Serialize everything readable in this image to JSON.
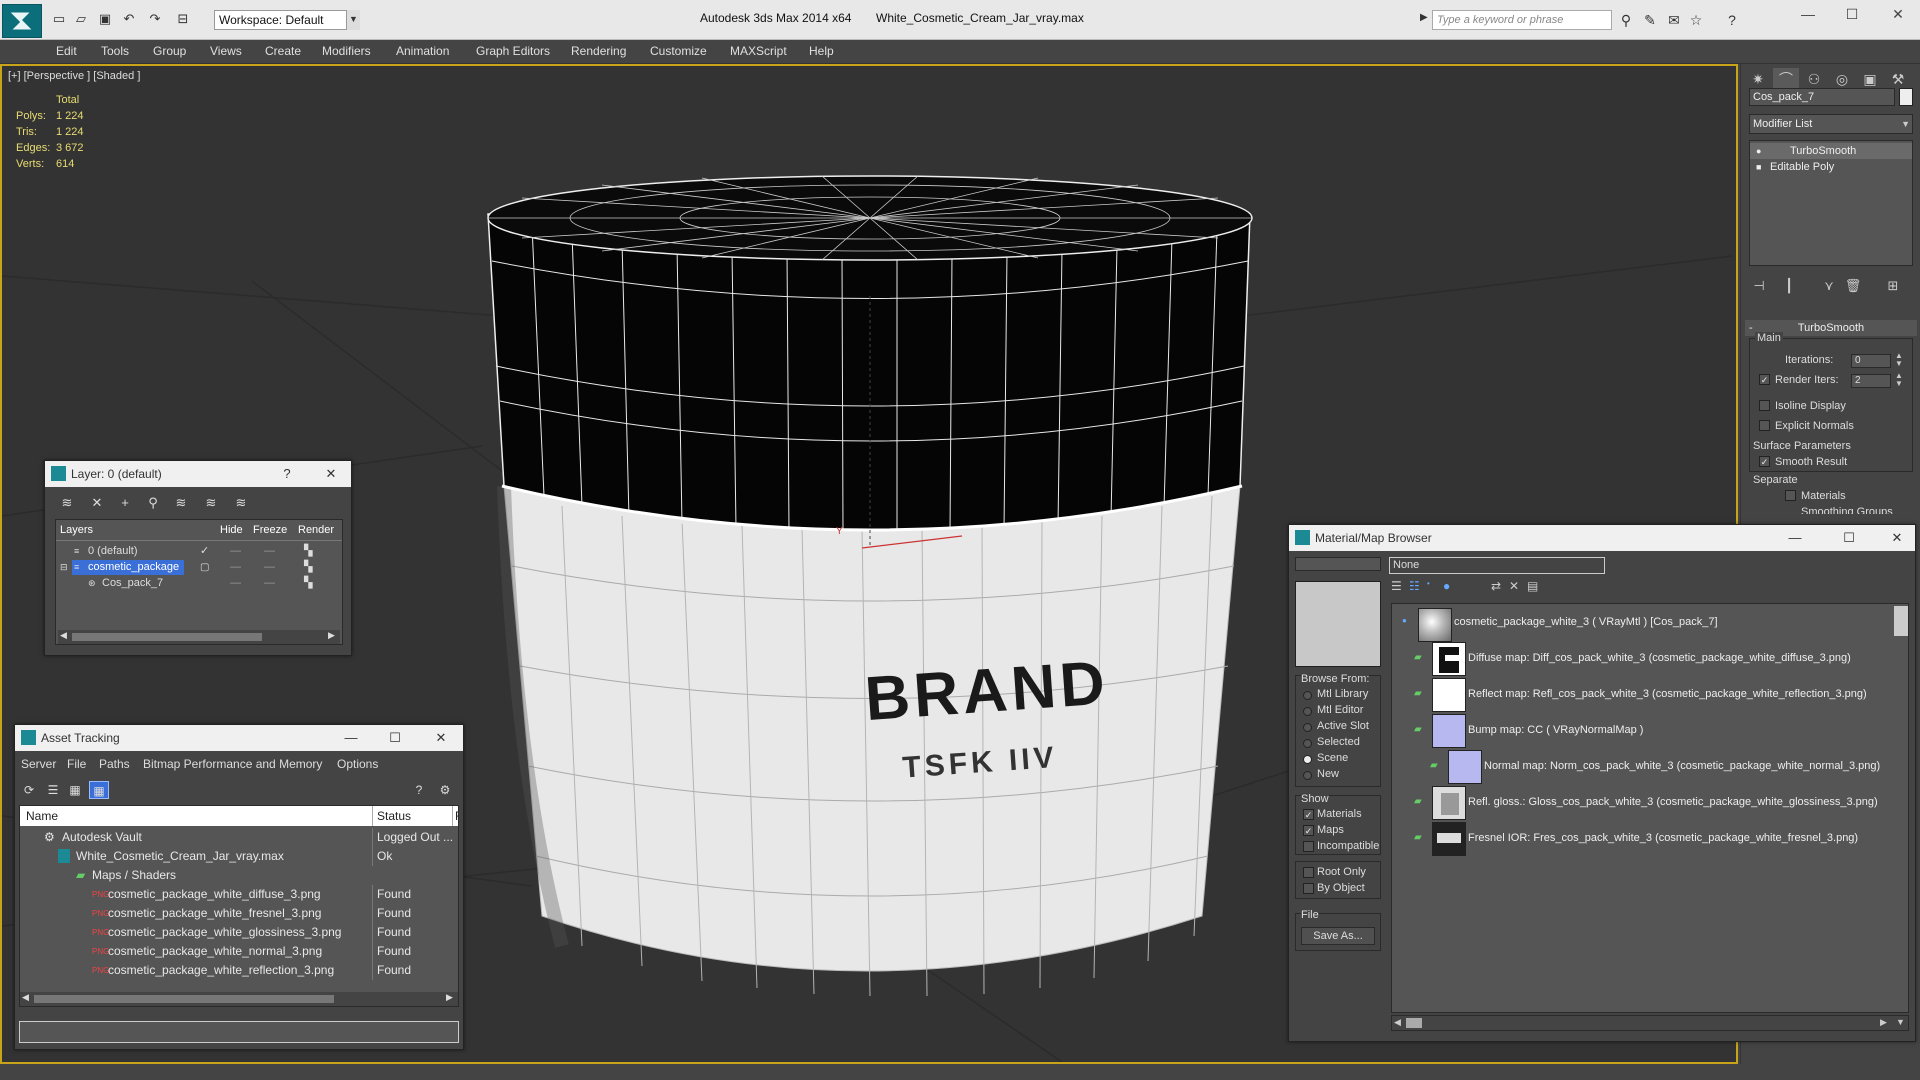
{
  "titlebar": {
    "workspace": "Workspace: Default",
    "app_title": "Autodesk 3ds Max  2014 x64",
    "file_name": "White_Cosmetic_Cream_Jar_vray.max",
    "search_placeholder": "Type a keyword or phrase"
  },
  "menu": {
    "items": [
      "Edit",
      "Tools",
      "Group",
      "Views",
      "Create",
      "Modifiers",
      "Animation",
      "Graph Editors",
      "Rendering",
      "Customize",
      "MAXScript",
      "Help"
    ]
  },
  "viewport": {
    "label": "[+] [Perspective ] [Shaded ]",
    "stats": {
      "header": "Total",
      "polys_label": "Polys:",
      "polys": "1 224",
      "tris_label": "Tris:",
      "tris": "1 224",
      "edges_label": "Edges:",
      "edges": "3 672",
      "verts_label": "Verts:",
      "verts": "614"
    },
    "model_label_brand": "BRAND",
    "model_label_sub": "TSFK IIV"
  },
  "command_panel": {
    "object_name": "Cos_pack_7",
    "modifier_list": "Modifier List",
    "stack": [
      "TurboSmooth",
      "Editable Poly"
    ],
    "turbosmooth": {
      "title": "TurboSmooth",
      "main_label": "Main",
      "iterations_label": "Iterations:",
      "iterations": "0",
      "render_iters_label": "Render Iters:",
      "render_iters": "2",
      "isoline_label": "Isoline Display",
      "explicit_normals_label": "Explicit Normals",
      "surface_params_label": "Surface Parameters",
      "smooth_result_label": "Smooth Result",
      "separate_label": "Separate",
      "materials_label": "Materials",
      "smoothing_groups_label": "Smoothing Groups"
    }
  },
  "layer_window": {
    "title": "Layer: 0 (default)",
    "help": "?",
    "headers": {
      "layers": "Layers",
      "hide": "Hide",
      "freeze": "Freeze",
      "render": "Render"
    },
    "rows": [
      "0 (default)",
      "cosmetic_package",
      "Cos_pack_7"
    ]
  },
  "asset_tracking": {
    "title": "Asset Tracking",
    "menu": [
      "Server",
      "File",
      "Paths",
      "Bitmap Performance and Memory",
      "Options"
    ],
    "headers": {
      "name": "Name",
      "status": "Status",
      "extra": "F"
    },
    "rows": [
      {
        "name": "Autodesk Vault",
        "status": "Logged Out ..."
      },
      {
        "name": "White_Cosmetic_Cream_Jar_vray.max",
        "status": "Ok"
      },
      {
        "name": "Maps / Shaders",
        "status": ""
      },
      {
        "name": "cosmetic_package_white_diffuse_3.png",
        "status": "Found"
      },
      {
        "name": "cosmetic_package_white_fresnel_3.png",
        "status": "Found"
      },
      {
        "name": "cosmetic_package_white_glossiness_3.png",
        "status": "Found"
      },
      {
        "name": "cosmetic_package_white_normal_3.png",
        "status": "Found"
      },
      {
        "name": "cosmetic_package_white_reflection_3.png",
        "status": "Found"
      }
    ]
  },
  "material_browser": {
    "title": "Material/Map Browser",
    "name_field": "None",
    "browse_from_label": "Browse From:",
    "browse_from": [
      "Mtl Library",
      "Mtl Editor",
      "Active Slot",
      "Selected",
      "Scene",
      "New"
    ],
    "show_label": "Show",
    "show": [
      "Materials",
      "Maps",
      "Incompatible"
    ],
    "root_only": "Root Only",
    "by_object": "By Object",
    "file_label": "File",
    "save_as": "Save As...",
    "tree": [
      "cosmetic_package_white_3  ( VRayMtl )  [Cos_pack_7]",
      "Diffuse map: Diff_cos_pack_white_3 (cosmetic_package_white_diffuse_3.png)",
      "Reflect map: Refl_cos_pack_white_3 (cosmetic_package_white_reflection_3.png)",
      "Bump map: CC  ( VRayNormalMap )",
      "Normal map: Norm_cos_pack_white_3 (cosmetic_package_white_normal_3.png)",
      "Refl. gloss.: Gloss_cos_pack_white_3 (cosmetic_package_white_glossiness_3.png)",
      "Fresnel IOR: Fres_cos_pack_white_3 (cosmetic_package_white_fresnel_3.png)"
    ]
  },
  "colors": {
    "viewport_border": "#c7a41a",
    "stats_text": "#e8dc72",
    "selection": "#3a6fd8",
    "bump_swatch": "#b8b8f0"
  }
}
